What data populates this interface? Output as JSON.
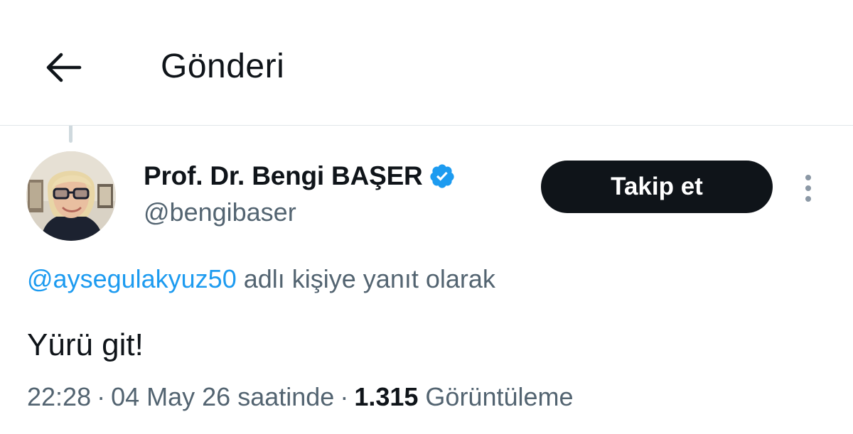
{
  "header": {
    "title": "Gönderi",
    "back_icon": "arrow-left-icon"
  },
  "tweet": {
    "author": {
      "display_name": "Prof. Dr. Bengi BAŞER",
      "handle": "@bengibaser",
      "verified_icon": "verified-badge-icon",
      "verified_color": "#1d9bf0"
    },
    "follow_label": "Takip et",
    "more_icon": "more-vertical-icon",
    "reply_to": {
      "handle": "@aysegulakyuz50",
      "suffix": "adlı kişiye yanıt olarak"
    },
    "text": "Yürü git!",
    "meta": {
      "time": "22:28",
      "separator": "·",
      "date": "04 May 26 saatinde",
      "views_count": "1.315",
      "views_label": "Görüntüleme"
    }
  },
  "colors": {
    "text_primary": "#0f1419",
    "text_secondary": "#536471",
    "link": "#1d9bf0",
    "button_bg": "#0f1419",
    "divider": "#e1e6ea"
  }
}
